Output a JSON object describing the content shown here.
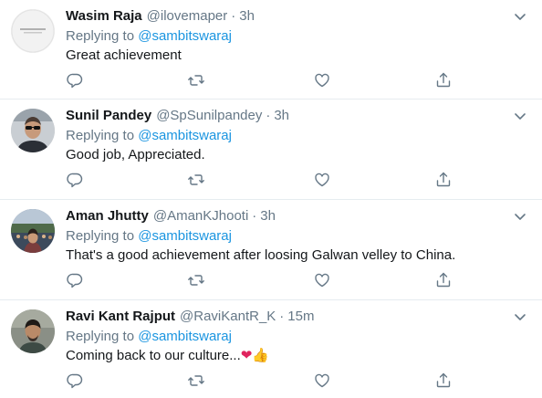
{
  "tweets": [
    {
      "name": "Wasim Raja",
      "handle": "@ilovemaper",
      "time": "3h",
      "replying_prefix": "Replying to",
      "replying_to": "@sambitswaraj",
      "text": "Great achievement",
      "avatar": "logo-badge-avatar"
    },
    {
      "name": "Sunil Pandey",
      "handle": "@SpSunilpandey",
      "time": "3h",
      "replying_prefix": "Replying to",
      "replying_to": "@sambitswaraj",
      "text": "Good job, Appreciated.",
      "avatar": "man-sunglasses-avatar"
    },
    {
      "name": "Aman Jhutty",
      "handle": "@AmanKJhooti",
      "time": "3h",
      "replying_prefix": "Replying to",
      "replying_to": "@sambitswaraj",
      "text": "That's a good achievement after loosing Galwan velley to China.",
      "avatar": "stadium-crowd-avatar"
    },
    {
      "name": "Ravi Kant Rajput",
      "handle": "@RaviKantR_K",
      "time": "15m",
      "replying_prefix": "Replying to",
      "replying_to": "@sambitswaraj",
      "text": "Coming back to our culture...",
      "text_emojis": [
        "❤",
        "👍"
      ],
      "avatar": "man-portrait-avatar"
    }
  ],
  "separator": "·",
  "colors": {
    "link": "#1b95e0",
    "secondary_text": "#657786",
    "divider": "#e6ecf0",
    "heart": "#e0245e"
  }
}
